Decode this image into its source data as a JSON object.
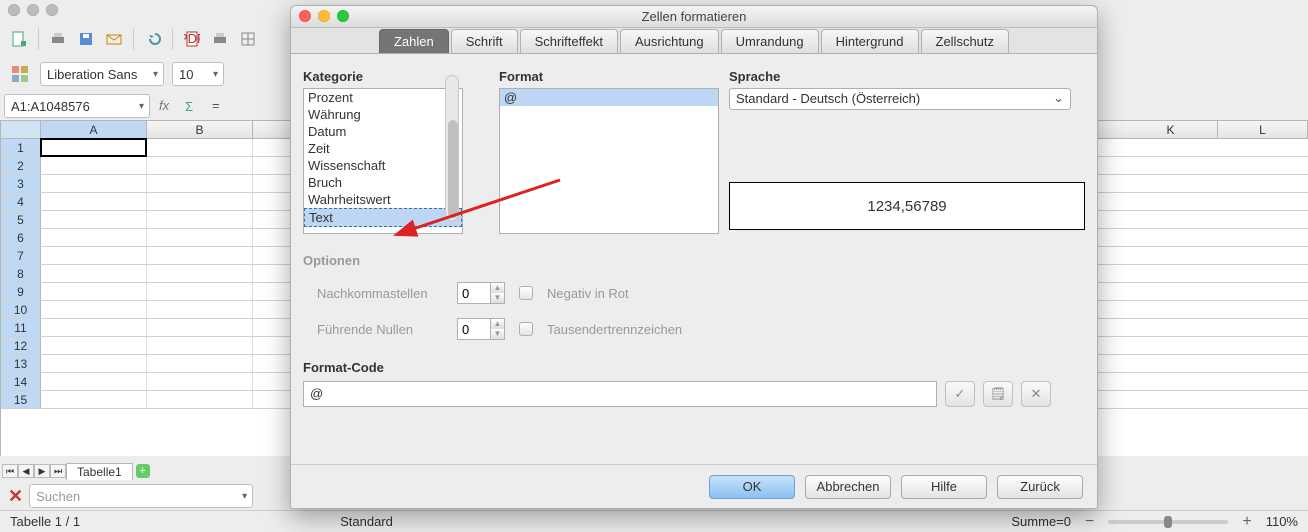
{
  "main": {
    "font_name": "Liberation Sans",
    "font_size": "10",
    "cell_ref": "A1:A1048576",
    "columns": [
      "A",
      "B",
      "K",
      "L"
    ],
    "rows_left": [
      "1",
      "2",
      "3",
      "4",
      "5",
      "6",
      "7",
      "8",
      "9",
      "10",
      "11",
      "12",
      "13",
      "14",
      "15"
    ],
    "sheet_tab": "Tabelle1",
    "find_placeholder": "Suchen",
    "status_sheet": "Tabelle 1 / 1",
    "status_std": "Standard",
    "status_sum": "Summe=0",
    "zoom": "110%"
  },
  "dialog": {
    "title": "Zellen formatieren",
    "tabs": [
      "Zahlen",
      "Schrift",
      "Schrifteffekt",
      "Ausrichtung",
      "Umrandung",
      "Hintergrund",
      "Zellschutz"
    ],
    "active_tab": 0,
    "kategorie_label": "Kategorie",
    "kategorie_items": [
      "Prozent",
      "Währung",
      "Datum",
      "Zeit",
      "Wissenschaft",
      "Bruch",
      "Wahrheitswert",
      "Text"
    ],
    "kategorie_selected": 7,
    "format_label": "Format",
    "format_items": [
      "@"
    ],
    "sprache_label": "Sprache",
    "sprache_value": "Standard - Deutsch (Österreich)",
    "preview_value": "1234,56789",
    "optionen_label": "Optionen",
    "nachkomma_label": "Nachkommastellen",
    "nachkomma_value": "0",
    "negrot_label": "Negativ in Rot",
    "fuehrend_label": "Führende Nullen",
    "fuehrend_value": "0",
    "tausender_label": "Tausendertrennzeichen",
    "formatcode_label": "Format-Code",
    "formatcode_value": "@",
    "btn_ok": "OK",
    "btn_cancel": "Abbrechen",
    "btn_help": "Hilfe",
    "btn_back": "Zurück"
  }
}
